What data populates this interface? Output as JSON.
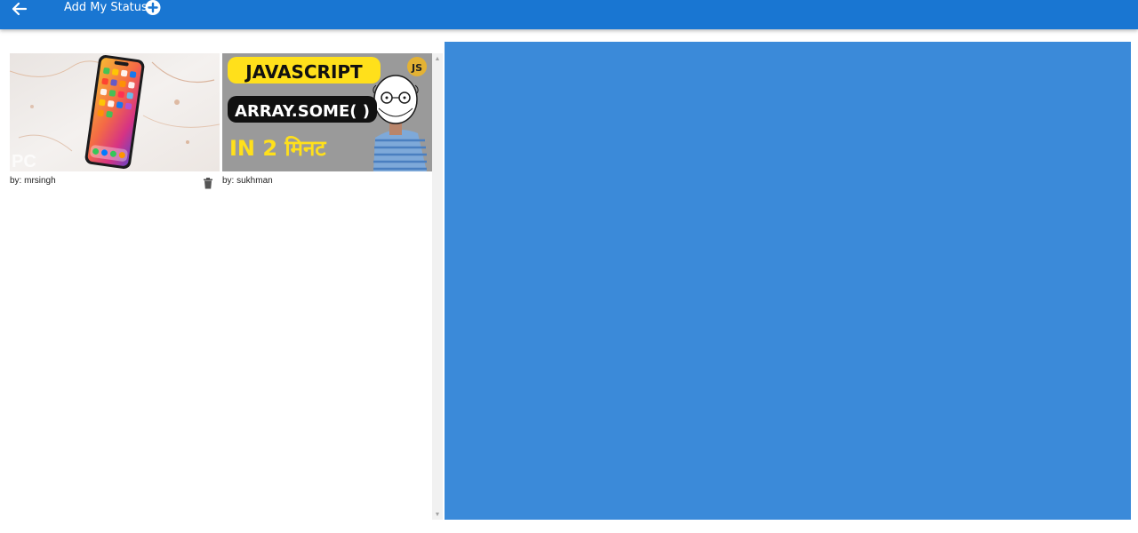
{
  "appbar": {
    "title": "Add My Status",
    "bg_color": "#1976d2"
  },
  "statuses": [
    {
      "author": "by: mrsingh",
      "thumbnail": "iphone-photo",
      "watermark": "PC",
      "deletable": true
    },
    {
      "author": "by: sukhman",
      "thumbnail": "javascript-video-thumb",
      "lines": [
        "JAVASCRIPT",
        "ARRAY.SOME( )",
        "IN 2 मिनट"
      ],
      "badge": "JS",
      "deletable": false
    }
  ],
  "viewer": {
    "bg_color": "#3b8ad9"
  }
}
